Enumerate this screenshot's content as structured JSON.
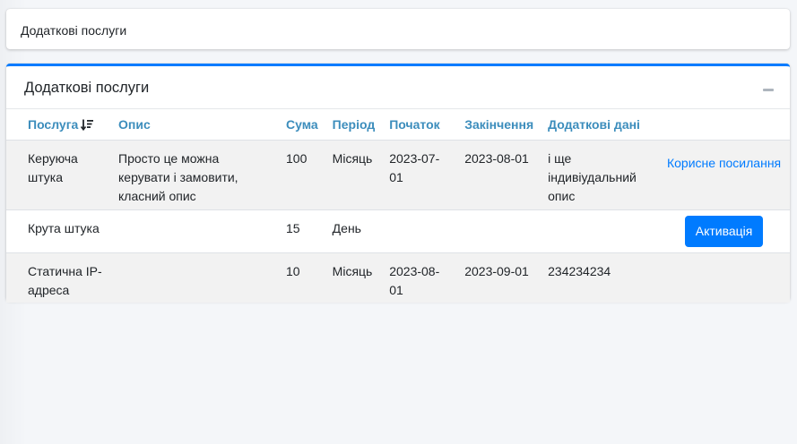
{
  "breadcrumb": {
    "title": "Додаткові послуги"
  },
  "card": {
    "title": "Додаткові послуги",
    "accent_color": "#007bff"
  },
  "table": {
    "headers": {
      "service": "Послуга",
      "description": "Опис",
      "sum": "Сума",
      "period": "Період",
      "start": "Початок",
      "end": "Закінчення",
      "extra": "Додаткові дані"
    },
    "rows": [
      {
        "service": "Керуюча штука",
        "description": "Просто це можна керувати і замовити, класний опис",
        "sum": "100",
        "period": "Місяць",
        "start": "2023-07-01",
        "end": "2023-08-01",
        "extra": "і ще індивіудальний опис",
        "action": "Корисне посилання"
      },
      {
        "service": "Крута штука",
        "description": "",
        "sum": "15",
        "period": "День",
        "start": "",
        "end": "",
        "extra": "",
        "action": "Активація"
      },
      {
        "service": "Статична IP-адреса",
        "description": "",
        "sum": "10",
        "period": "Місяць",
        "start": "2023-08-01",
        "end": "2023-09-01",
        "extra": "234234234",
        "action": ""
      }
    ]
  }
}
